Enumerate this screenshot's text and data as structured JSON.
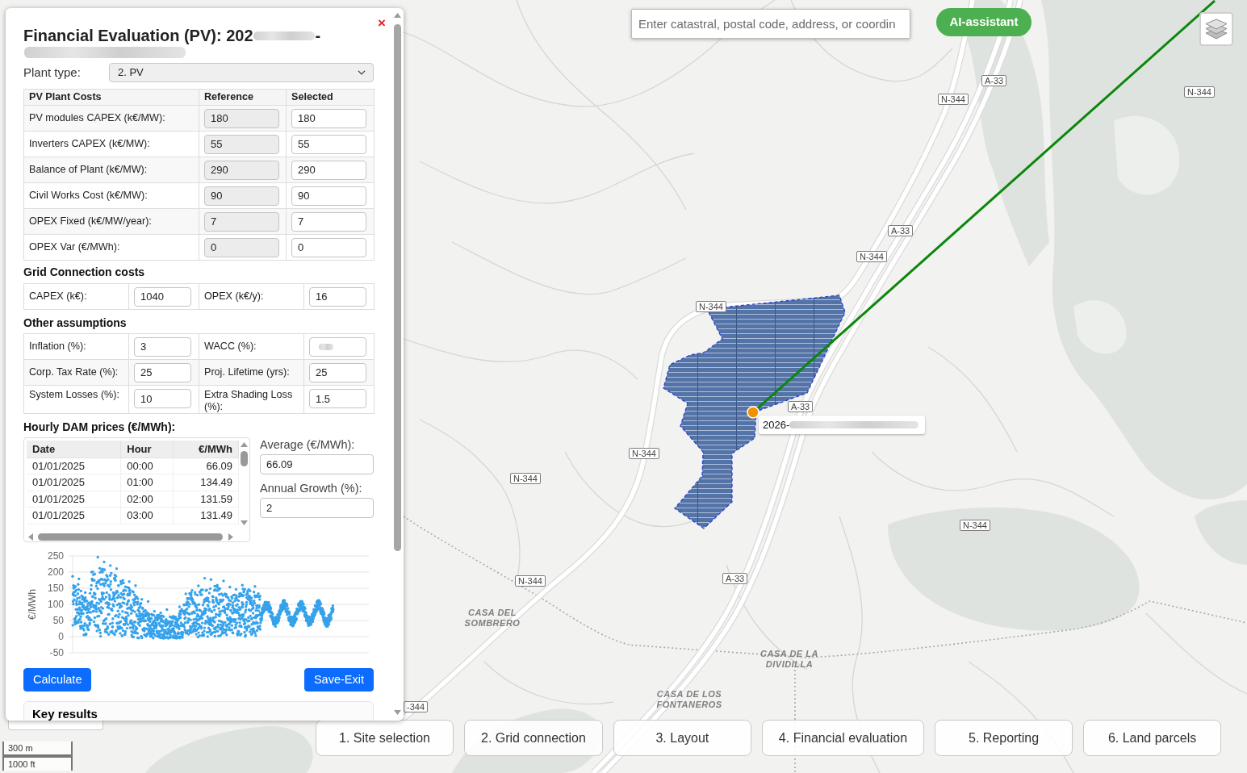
{
  "panel": {
    "title": {
      "text": "Financial Evaluation (PV): 202",
      "end": "-",
      "redacted": true
    },
    "close": "×",
    "plant_type": {
      "label": "Plant type:",
      "value": "2. PV"
    },
    "plant_costs": {
      "columns": [
        "PV Plant Costs",
        "Reference",
        "Selected"
      ],
      "rows": [
        {
          "label": "PV modules CAPEX (k€/MW):",
          "reference": "180",
          "value": "180"
        },
        {
          "label": "Inverters CAPEX (k€/MW):",
          "reference": "55",
          "value": "55"
        },
        {
          "label": "Balance of Plant (k€/MW):",
          "reference": "290",
          "value": "290"
        },
        {
          "label": "Civil Works Cost (k€/MW):",
          "reference": "90",
          "value": "90"
        },
        {
          "label": "OPEX Fixed (k€/MW/year):",
          "reference": "7",
          "value": "7"
        },
        {
          "label": "OPEX Var (€/MWh):",
          "reference": "0",
          "value": "0"
        }
      ]
    },
    "grid_connection": {
      "heading": "Grid Connection costs",
      "fields": [
        {
          "label": "CAPEX (k€):",
          "value": "1040"
        },
        {
          "label": "OPEX (k€/y):",
          "value": "16"
        }
      ]
    },
    "other_assumptions": {
      "heading": "Other assumptions",
      "fields": [
        {
          "label": "Inflation (%):",
          "value": "3"
        },
        {
          "label": "WACC (%):",
          "redacted": true
        },
        {
          "label": "Corp. Tax Rate (%):",
          "value": "25"
        },
        {
          "label": "Proj. Lifetime (yrs):",
          "value": "25"
        },
        {
          "label": "System Losses (%):",
          "value": "10"
        },
        {
          "label": "Extra Shading Loss (%):",
          "value": "1.5"
        }
      ]
    },
    "dam_prices": {
      "heading": "Hourly DAM prices (€/MWh):",
      "columns": [
        "Date",
        "Hour",
        "€/MWh"
      ],
      "rows": [
        [
          "01/01/2025",
          "00:00",
          "66.09"
        ],
        [
          "01/01/2025",
          "01:00",
          "134.49"
        ],
        [
          "01/01/2025",
          "02:00",
          "131.59"
        ],
        [
          "01/01/2025",
          "03:00",
          "131.49"
        ]
      ],
      "average": {
        "label": "Average (€/MWh):",
        "value": "66.09"
      },
      "growth": {
        "label": "Annual Growth (%):",
        "value": "2"
      }
    },
    "price_chart": {
      "chart_data": {
        "type": "scatter",
        "ylabel": "€/MWh",
        "yticks": [
          250,
          200,
          150,
          100,
          50,
          0,
          -50
        ],
        "ylim": [
          -50,
          250
        ],
        "grid": true,
        "series": [
          {
            "color": "#36a2eb"
          }
        ]
      }
    },
    "buttons": [
      "Calculate",
      "Save-Exit"
    ],
    "key_results": {
      "heading": "Key results"
    }
  },
  "map": {
    "search": {
      "placeholder": "Enter catastral, postal code, address, or coordin"
    },
    "assistant_button": "AI-assistant",
    "road_labels": [
      "A-33",
      "N-344",
      "N-344",
      "A-33",
      "N-344",
      "N-344",
      "A-33",
      "N-344",
      "N-344",
      "N-344",
      "N-344",
      "A-33",
      "-344"
    ],
    "site_label": {
      "text": "2026-",
      "redacted": true
    },
    "place_labels": [
      "CASA DEL SOMBRERO",
      "CASA DE LA DIVIDILLA",
      "CASA DE LOS FONTANEROS"
    ],
    "scale": [
      "300 m",
      "1000 ft"
    ]
  },
  "steps": [
    "1. Site selection",
    "2. Grid connection",
    "3. Layout",
    "4. Financial evaluation",
    "5. Reporting",
    "6. Land parcels"
  ]
}
